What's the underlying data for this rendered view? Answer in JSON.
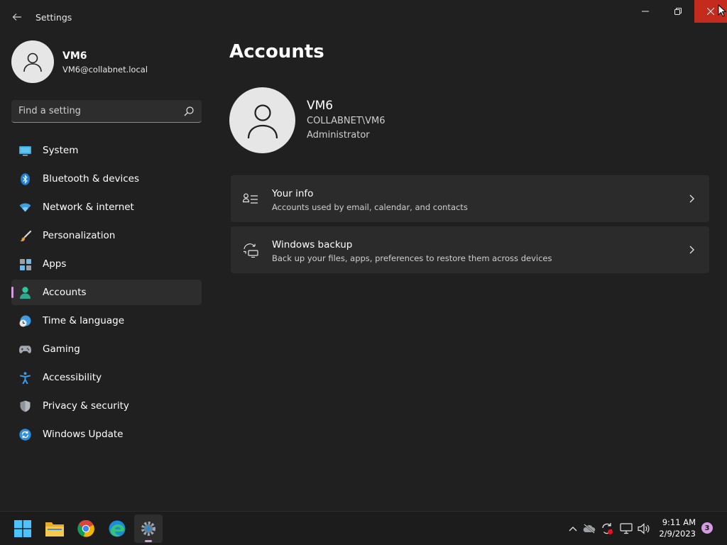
{
  "window": {
    "title": "Settings",
    "back_icon": "back-arrow-icon",
    "controls": [
      "minimize-icon",
      "restore-icon",
      "close-icon"
    ],
    "close_hover_color": "#c42b1c"
  },
  "profile": {
    "name": "VM6",
    "email": "VM6@collabnet.local"
  },
  "search": {
    "placeholder": "Find a setting"
  },
  "sidebar": {
    "accent_color": "#d59be0",
    "active_index": 5,
    "items": [
      {
        "label": "System",
        "icon": "monitor-icon"
      },
      {
        "label": "Bluetooth & devices",
        "icon": "bluetooth-icon"
      },
      {
        "label": "Network & internet",
        "icon": "wifi-icon"
      },
      {
        "label": "Personalization",
        "icon": "brush-icon"
      },
      {
        "label": "Apps",
        "icon": "apps-icon"
      },
      {
        "label": "Accounts",
        "icon": "person-icon"
      },
      {
        "label": "Time & language",
        "icon": "clock-globe-icon"
      },
      {
        "label": "Gaming",
        "icon": "controller-icon"
      },
      {
        "label": "Accessibility",
        "icon": "accessibility-icon"
      },
      {
        "label": "Privacy & security",
        "icon": "shield-icon"
      },
      {
        "label": "Windows Update",
        "icon": "sync-icon"
      }
    ]
  },
  "main": {
    "title": "Accounts",
    "user": {
      "name": "VM6",
      "domain": "COLLABNET\\VM6",
      "role": "Administrator"
    },
    "cards": [
      {
        "title": "Your info",
        "subtitle": "Accounts used by email, calendar, and contacts",
        "icon": "contact-card-icon"
      },
      {
        "title": "Windows backup",
        "subtitle": "Back up your files, apps, preferences to restore them across devices",
        "icon": "backup-icon"
      }
    ]
  },
  "taskbar": {
    "apps": [
      "start-icon",
      "file-explorer-icon",
      "chrome-icon",
      "edge-icon",
      "settings-icon"
    ],
    "tray": [
      "chevron-up-icon",
      "onedrive-icon",
      "sync-alert-icon",
      "display-icon",
      "volume-icon"
    ],
    "time": "9:11 AM",
    "date": "2/9/2023",
    "notification_count": "3"
  }
}
